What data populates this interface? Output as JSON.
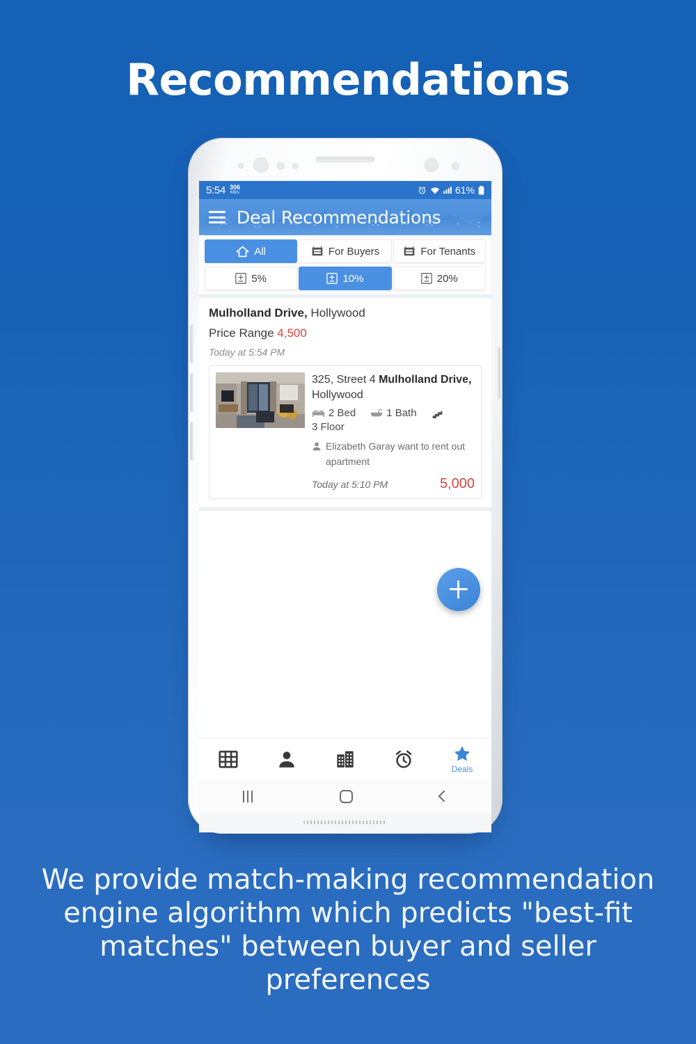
{
  "headline": "Recommendations",
  "caption": "We provide match-making recommendation engine algorithm which predicts \"best-fit matches\" between buyer and seller preferences",
  "colors": {
    "background_top": "#1461b5",
    "background_bottom": "#2a6dc0",
    "accent_blue": "#4a90e2",
    "appbar_blue": "#4f90dd",
    "statusbar_blue": "#2a74cc",
    "price_red": "#e0413d",
    "text_dark": "#3c3c3c",
    "text_muted": "#8b8b8b"
  },
  "status_bar": {
    "time": "5:54",
    "network_speed_value": "306",
    "network_speed_unit": "KB/s",
    "battery_percent": "61%",
    "icons": [
      "alarm-icon",
      "wifi-icon",
      "signal-icon",
      "battery-icon"
    ]
  },
  "app_bar": {
    "menu_icon": "hamburger-menu-icon",
    "title": "Deal Recommendations"
  },
  "filter_tabs": [
    {
      "label": "All",
      "icon": "home-icon",
      "selected": true
    },
    {
      "label": "For Buyers",
      "icon": "for-sale-sign-icon",
      "selected": false
    },
    {
      "label": "For Tenants",
      "icon": "for-rent-sign-icon",
      "selected": false
    }
  ],
  "percent_tabs": [
    {
      "label": "5%",
      "icon": "plus-minus-icon",
      "selected": false
    },
    {
      "label": "10%",
      "icon": "plus-minus-icon",
      "selected": true
    },
    {
      "label": "20%",
      "icon": "plus-minus-icon",
      "selected": false
    }
  ],
  "deal": {
    "location_bold": "Mulholland Drive,",
    "location_rest": " Hollywood",
    "price_range_label": "Price Range ",
    "price_range_value": "4,500",
    "timestamp": "Today at 5:54 PM"
  },
  "listing": {
    "address_prefix": "325, Street 4 ",
    "address_bold": "Mulholland Drive,",
    "address_suffix": " Hollywood",
    "thumbnail_alt": "apartment-living-room-photo",
    "features": [
      {
        "icon": "bed-icon",
        "label": "2 Bed"
      },
      {
        "icon": "bath-icon",
        "label": "1 Bath"
      },
      {
        "icon": "stairs-icon",
        "label": ""
      }
    ],
    "floor": "3 Floor",
    "person_icon": "person-icon",
    "person_note": "Elizabeth Garay want to rent out apartment",
    "timestamp": "Today at 5:10 PM",
    "amount": "5,000"
  },
  "fab": {
    "icon": "plus-icon",
    "label": "Add"
  },
  "bottom_nav": [
    {
      "icon": "grid-icon",
      "label": "",
      "selected": false
    },
    {
      "icon": "person-icon",
      "label": "",
      "selected": false
    },
    {
      "icon": "building-icon",
      "label": "",
      "selected": false
    },
    {
      "icon": "alarm-clock-icon",
      "label": "",
      "selected": false
    },
    {
      "icon": "star-icon",
      "label": "Deals",
      "selected": true
    }
  ],
  "android_nav": [
    {
      "icon": "recents-icon"
    },
    {
      "icon": "home-icon"
    },
    {
      "icon": "back-icon"
    }
  ]
}
